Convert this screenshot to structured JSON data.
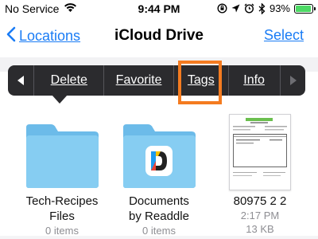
{
  "status_bar": {
    "carrier": "No Service",
    "time": "9:44 PM",
    "battery_percent": "93%",
    "battery_level": 0.93,
    "icons": [
      "wifi-icon",
      "screen-rotation-lock-icon",
      "location-icon",
      "alarm-icon",
      "bluetooth-icon",
      "battery-icon"
    ]
  },
  "nav": {
    "back_label": "Locations",
    "title": "iCloud Drive",
    "select_label": "Select"
  },
  "context_menu": {
    "items": [
      {
        "label": "Delete"
      },
      {
        "label": "Favorite"
      },
      {
        "label": "Tags"
      },
      {
        "label": "Info"
      }
    ],
    "highlighted": "Tags"
  },
  "files": [
    {
      "name_line1": "Tech-Recipes",
      "name_line2": "Files",
      "meta1": "0 items",
      "icon": "folder-icon"
    },
    {
      "name_line1": "Documents",
      "name_line2": "by Readdle",
      "meta1": "0 items",
      "icon": "documents-app-folder-icon"
    },
    {
      "name_line1": "80975 2 2",
      "meta1": "2:17 PM",
      "meta2": "13 KB",
      "icon": "document-thumbnail"
    }
  ],
  "colors": {
    "accent": "#1a7cf5",
    "menu_bg": "#2b2b2e",
    "highlight": "#f47b20",
    "folder": "#7ec8f0",
    "battery": "#4cd964"
  }
}
